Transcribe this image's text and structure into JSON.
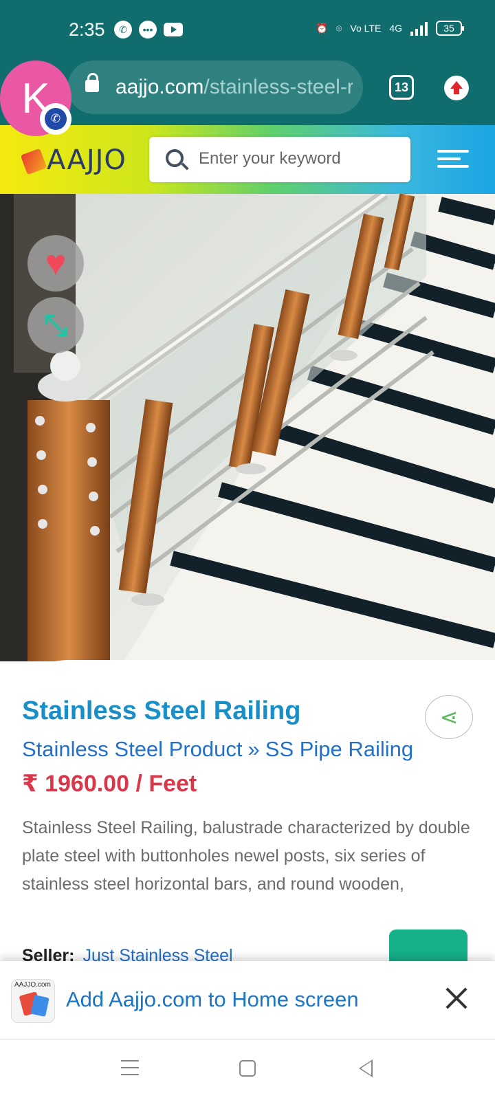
{
  "status_bar": {
    "time": "2:35",
    "battery": "35",
    "network": "4G",
    "volte": "Vo LTE"
  },
  "browser": {
    "url_domain": "aajjo.com",
    "url_path": "/stainless-steel-railing",
    "tab_count": "13",
    "avatar_letter": "K"
  },
  "site": {
    "logo": "AAJJO",
    "search_placeholder": "Enter your keyword"
  },
  "product": {
    "image_alt": "Stainless steel staircase railing with glass panels and wooden posts",
    "title": "Stainless Steel Railing",
    "breadcrumb": [
      "Stainless Steel Product",
      "SS Pipe Railing"
    ],
    "breadcrumb_separator": "»",
    "price": "₹ 1960.00 / Feet",
    "description": "Stainless Steel Railing, balustrade characterized by double plate steel with buttonholes newel posts, six series of stainless steel horizontal bars, and round wooden,",
    "seller_label": "Seller:",
    "seller_name": "Just Stainless Steel"
  },
  "a2hs": {
    "text": "Add Aajjo.com to Home screen",
    "icon_text": "AAJJO.com"
  },
  "colors": {
    "status_bar": "#106c6d",
    "title": "#1a8fc7",
    "link": "#2270c8",
    "price": "#d9384a",
    "accent_green": "#16b08a"
  }
}
